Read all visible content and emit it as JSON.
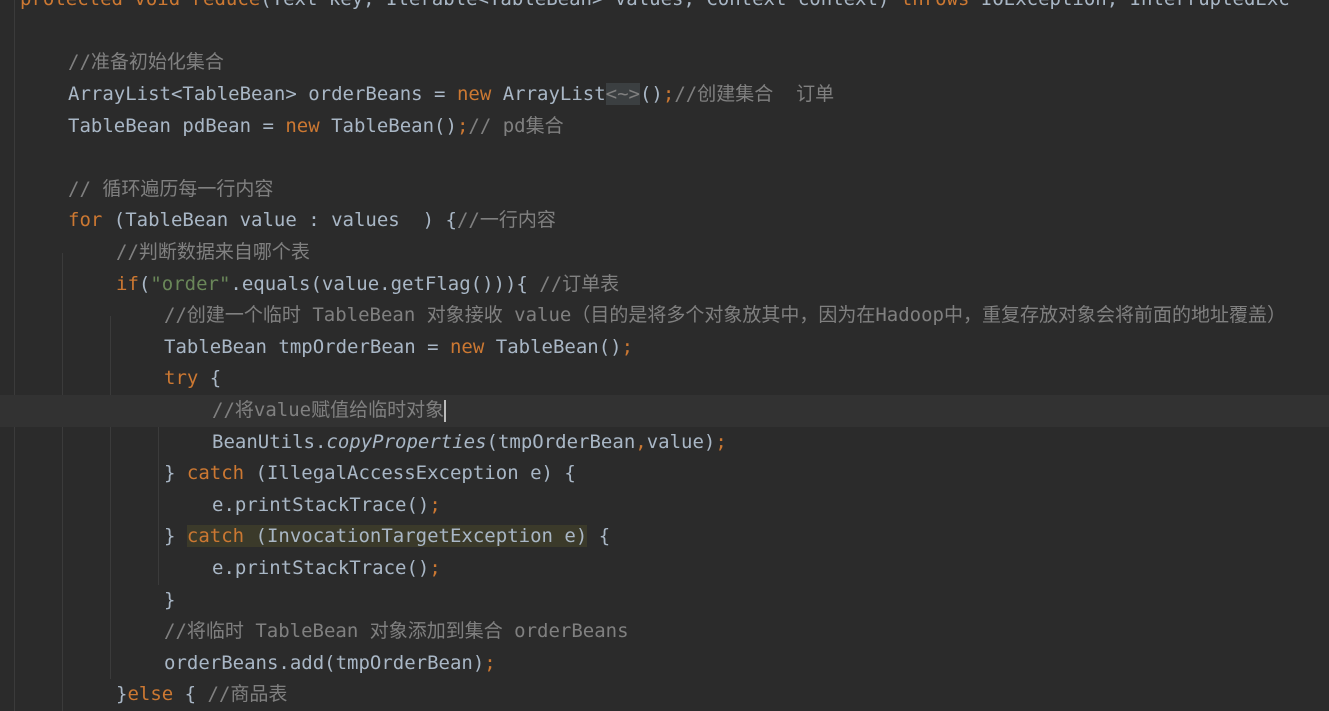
{
  "editor": {
    "lines": [
      [
        {
          "t": "protected void reduce",
          "c": "kw"
        },
        {
          "t": "(Text key, Iterable<TableBean> values, Context context) "
        },
        {
          "t": "throws ",
          "c": "kw"
        },
        {
          "t": "IOException, InterruptedExc"
        }
      ],
      [],
      [
        {
          "t": "//准备初始化集合",
          "c": "cm"
        }
      ],
      [
        {
          "t": "ArrayList<TableBean> orderBeans = "
        },
        {
          "t": "new ",
          "c": "kw"
        },
        {
          "t": "ArrayList"
        },
        {
          "t": "<~>",
          "c": "diamond"
        },
        {
          "t": "()"
        },
        {
          "t": ";",
          "c": "kw"
        },
        {
          "t": "//创建集合  订单",
          "c": "cm"
        }
      ],
      [
        {
          "t": "TableBean pdBean = "
        },
        {
          "t": "new ",
          "c": "kw"
        },
        {
          "t": "TableBean()"
        },
        {
          "t": ";",
          "c": "kw"
        },
        {
          "t": "// pd集合",
          "c": "cm"
        }
      ],
      [],
      [
        {
          "t": "// 循环遍历每一行内容",
          "c": "cm"
        }
      ],
      [
        {
          "t": "for ",
          "c": "kw"
        },
        {
          "t": "(TableBean value : values  ) {"
        },
        {
          "t": "//一行内容",
          "c": "cm"
        }
      ],
      [
        {
          "t": "//判断数据来自哪个表",
          "c": "cm"
        }
      ],
      [
        {
          "t": "if",
          "c": "kw"
        },
        {
          "t": "("
        },
        {
          "t": "\"order\"",
          "c": "str"
        },
        {
          "t": ".equals(value.getFlag())){ "
        },
        {
          "t": "//订单表",
          "c": "cm"
        }
      ],
      [
        {
          "t": "//创建一个临时 TableBean 对象接收 value（目的是将多个对象放其中，因为在Hadoop中，重复存放对象会将前面的地址覆盖）",
          "c": "cm"
        }
      ],
      [
        {
          "t": "TableBean tmpOrderBean = "
        },
        {
          "t": "new ",
          "c": "kw"
        },
        {
          "t": "TableBean()"
        },
        {
          "t": ";",
          "c": "kw"
        }
      ],
      [
        {
          "t": "try ",
          "c": "kw"
        },
        {
          "t": "{"
        }
      ],
      [
        {
          "t": "//将value赋值给临时对象",
          "c": "cm"
        },
        {
          "t": "",
          "c": "caret"
        }
      ],
      [
        {
          "t": "BeanUtils."
        },
        {
          "t": "copyProperties",
          "c": "it"
        },
        {
          "t": "(tmpOrderBean"
        },
        {
          "t": ",",
          "c": "kw"
        },
        {
          "t": "value)"
        },
        {
          "t": ";",
          "c": "kw"
        }
      ],
      [
        {
          "t": "} "
        },
        {
          "t": "catch ",
          "c": "kw"
        },
        {
          "t": "(IllegalAccessException e) {"
        }
      ],
      [
        {
          "t": "e.printStackTrace()"
        },
        {
          "t": ";",
          "c": "kw"
        }
      ],
      [
        {
          "t": "} "
        },
        {
          "t": "catch",
          "c": "kw hl"
        },
        {
          "t": " (InvocationTargetException e)",
          "c": "hl"
        },
        {
          "t": " {"
        }
      ],
      [
        {
          "t": "e.printStackTrace()"
        },
        {
          "t": ";",
          "c": "kw"
        }
      ],
      [
        {
          "t": "}"
        }
      ],
      [
        {
          "t": "//将临时 TableBean 对象添加到集合 orderBeans",
          "c": "cm"
        }
      ],
      [
        {
          "t": "orderBeans.add(tmpOrderBean)"
        },
        {
          "t": ";",
          "c": "kw"
        }
      ],
      [
        {
          "t": "}"
        },
        {
          "t": "else ",
          "c": "kw"
        },
        {
          "t": "{ "
        },
        {
          "t": "//商品表",
          "c": "cm"
        }
      ]
    ]
  }
}
